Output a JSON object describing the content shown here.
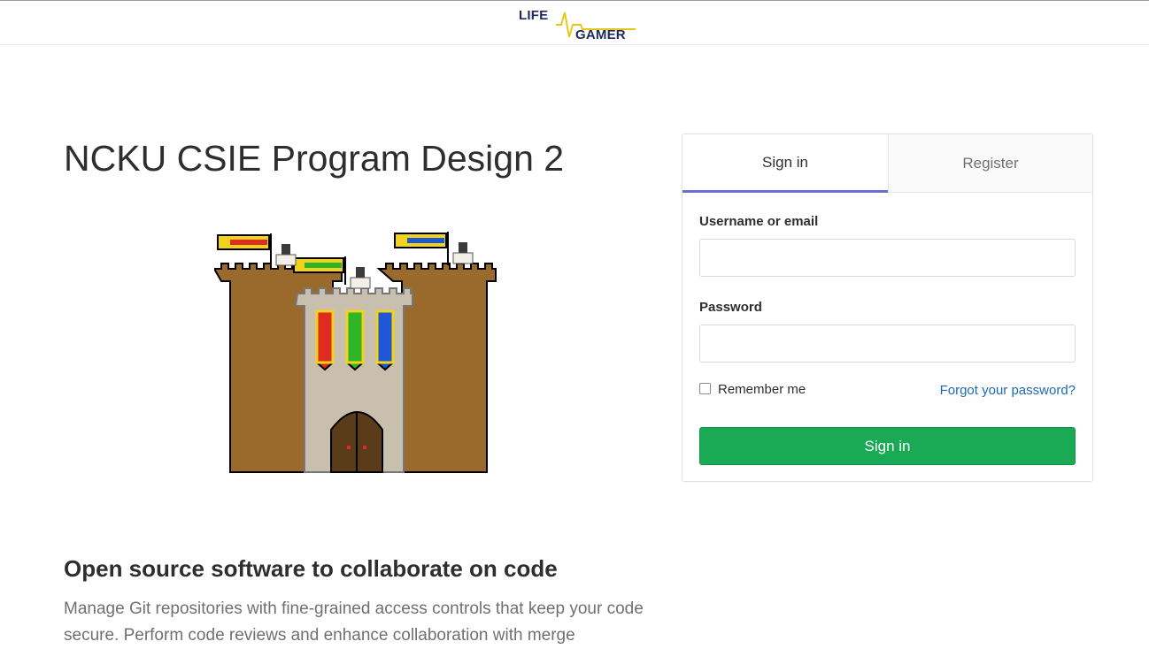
{
  "header": {
    "logo_line1": "LIFE",
    "logo_line2": "GAMER",
    "logo_color": "#1f2a5c",
    "logo_pulse_color": "#e6c61a"
  },
  "main": {
    "title": "NCKU CSIE Program Design 2",
    "subheading": "Open source software to collaborate on code",
    "description": "Manage Git repositories with fine-grained access controls that keep your code secure. Perform code reviews and enhance collaboration with merge"
  },
  "login": {
    "tabs": [
      {
        "label": "Sign in",
        "active": true
      },
      {
        "label": "Register",
        "active": false
      }
    ],
    "username_label": "Username or email",
    "username_value": "",
    "password_label": "Password",
    "password_value": "",
    "remember_label": "Remember me",
    "remember_checked": false,
    "forgot_label": "Forgot your password?",
    "submit_label": "Sign in"
  },
  "colors": {
    "accent_tab": "#6b6fd4",
    "primary_button": "#1aaa55",
    "link": "#1b69b6"
  }
}
